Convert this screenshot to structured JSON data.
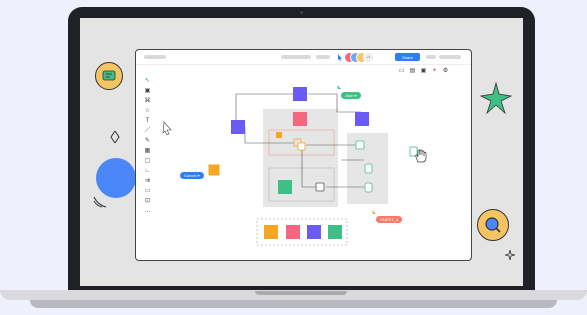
{
  "toolbar": {
    "share_label": "Share",
    "collaborator_count": "+1"
  },
  "canvas": {
    "label_json": "Json ▾",
    "label_cancel": "Cancel ▾",
    "label_guest": "GUEST_4"
  },
  "colors": {
    "purple": "#6b5bf5",
    "pink": "#f4677f",
    "green": "#3fbf86",
    "orange": "#f5a623",
    "blue": "#2d7ff9"
  },
  "icons": [
    "chat-icon",
    "star-icon",
    "diamond-icon",
    "search-icon",
    "pointer-icon",
    "hand-cursor-icon"
  ]
}
